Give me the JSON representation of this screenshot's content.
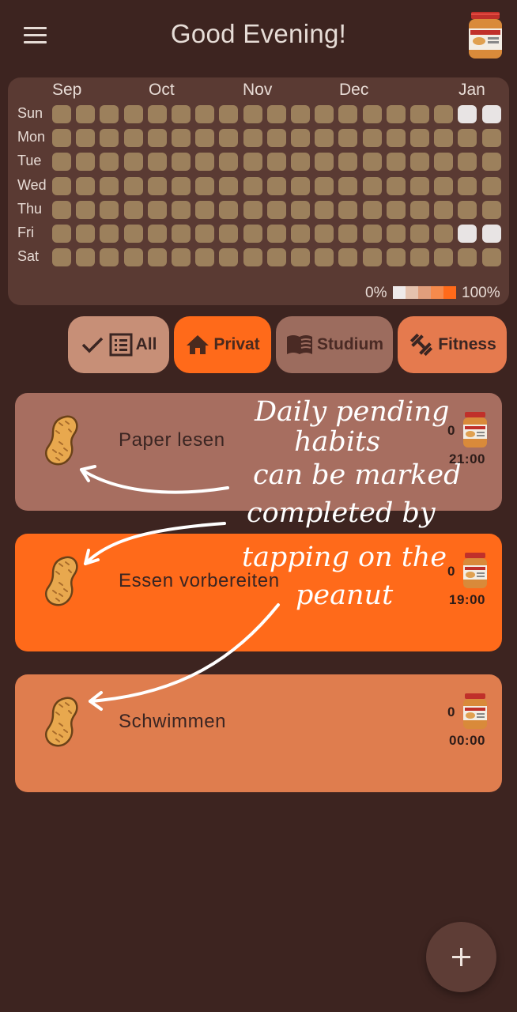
{
  "header": {
    "title": "Good Evening!",
    "menu_icon": "hamburger-menu-icon",
    "avatar_icon": "peanut-butter-jar-icon"
  },
  "heatmap": {
    "months": [
      "Sep",
      "Oct",
      "Nov",
      "Dec",
      "Jan"
    ],
    "days": [
      "Sun",
      "Mon",
      "Tue",
      "Wed",
      "Thu",
      "Fri",
      "Sat"
    ],
    "weeks": 19,
    "completed_cells": [
      {
        "day": "Sun",
        "week": 18
      },
      {
        "day": "Sun",
        "week": 19
      },
      {
        "day": "Fri",
        "week": 18
      },
      {
        "day": "Fri",
        "week": 19
      }
    ],
    "empty_color": "#9c805c",
    "completed_color": "#e8e4e4",
    "legend_min": "0%",
    "legend_max": "100%",
    "legend_colors": [
      "#eeeaea",
      "#e5c2ae",
      "#e09e7c",
      "#f58a4c",
      "#ff6a1a"
    ]
  },
  "filters": [
    {
      "label": "All",
      "icons": [
        "check-icon",
        "list-icon"
      ],
      "color": "#c78f77"
    },
    {
      "label": "Privat",
      "icons": [
        "home-icon"
      ],
      "color": "#ff6a1a",
      "selected": true
    },
    {
      "label": "Studium",
      "icons": [
        "book-icon"
      ],
      "color": "#9c6c5e"
    },
    {
      "label": "Fitness",
      "icons": [
        "dumbbell-icon"
      ],
      "color": "#e57a4e"
    }
  ],
  "habits": [
    {
      "name": "Paper lesen",
      "streak": "0",
      "time": "21:00",
      "color": "#a76e60"
    },
    {
      "name": "Essen vorbereiten",
      "streak": "0",
      "time": "19:00",
      "color": "#ff6a1a"
    },
    {
      "name": "Schwimmen",
      "streak": "0",
      "time": "00:00",
      "color": "#df7d4e"
    }
  ],
  "annotation": {
    "lines": [
      "Daily pending",
      "habits",
      "can be marked",
      "completed by",
      "tapping on the",
      "peanut"
    ]
  },
  "fab": {
    "label": "+",
    "icon": "plus-icon"
  }
}
